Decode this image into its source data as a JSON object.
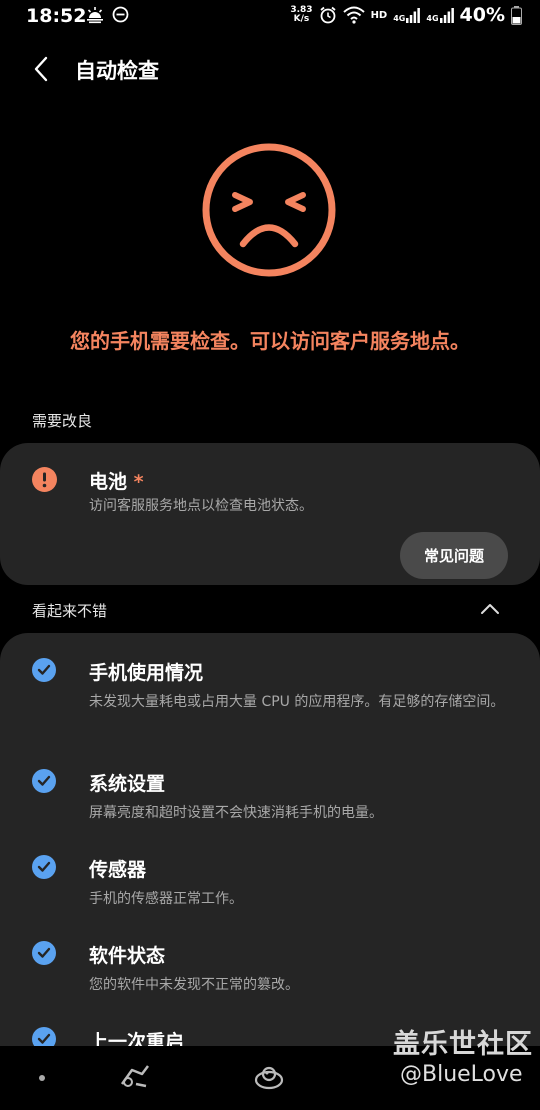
{
  "status_bar": {
    "time": "18:52",
    "speed_value": "3.83",
    "speed_unit": "K/s",
    "hd": "HD",
    "net1": "4G",
    "net2": "4G",
    "battery": "40%"
  },
  "header": {
    "title": "自动检查",
    "back_icon": "back-arrow-icon"
  },
  "status_face": "sad-face-icon",
  "alert_message": "您的手机需要检查。可以访问客户服务地点。",
  "needs_improvement": {
    "label": "需要改良",
    "item": {
      "title": "电池",
      "asterisk": "*",
      "description": "访问客服服务地点以检查电池状态。",
      "button": "常见问题",
      "icon": "warning-icon"
    }
  },
  "looks_good": {
    "label": "看起来不错",
    "items": [
      {
        "title": "手机使用情况",
        "description": "未发现大量耗电或占用大量 CPU 的应用程序。有足够的存储空间。"
      },
      {
        "title": "系统设置",
        "description": "屏幕亮度和超时设置不会快速消耗手机的电量。"
      },
      {
        "title": "传感器",
        "description": "手机的传感器正常工作。"
      },
      {
        "title": "软件状态",
        "description": "您的软件中未发现不正常的篡改。"
      },
      {
        "title": "上一次重启",
        "description": ""
      }
    ]
  },
  "watermark": {
    "line1": "盖乐世社区",
    "line2": "@BlueLove"
  },
  "colors": {
    "accent_orange": "#f4845f",
    "check_blue": "#5aa2f0",
    "card_bg": "#252525"
  }
}
